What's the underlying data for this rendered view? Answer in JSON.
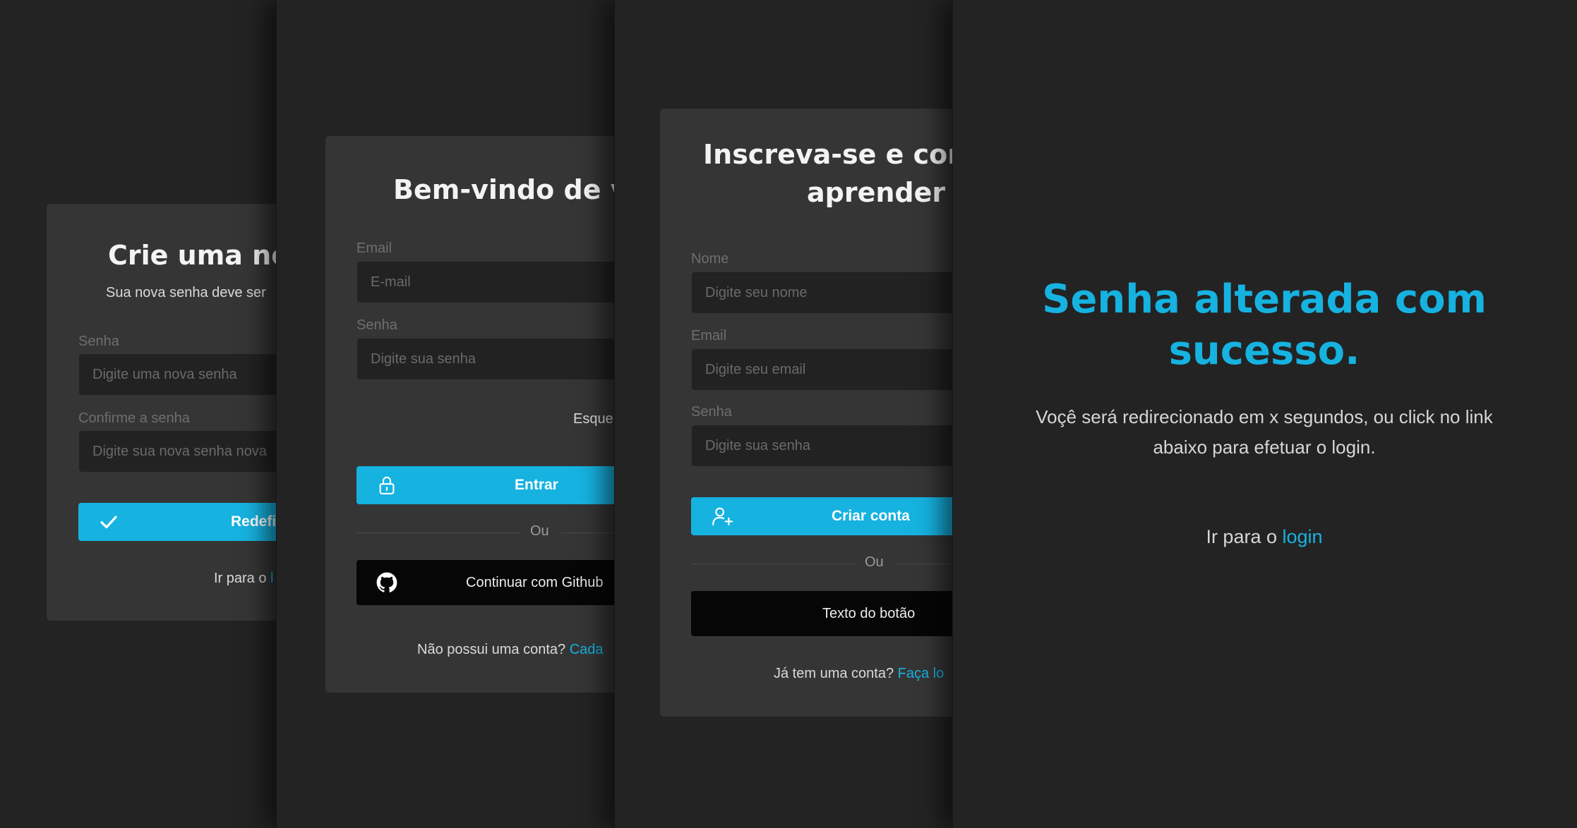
{
  "colors": {
    "accent": "#16b2e0",
    "background": "#232323",
    "card": "#353535",
    "input": "#222222",
    "dark_button": "#060606"
  },
  "reset_password": {
    "title": "Crie uma no",
    "subtitle": "Sua nova senha deve ser",
    "password_label": "Senha",
    "password_placeholder": "Digite uma nova senha",
    "confirm_label": "Confirme a senha",
    "confirm_placeholder": "Digite sua nova senha nova",
    "submit_label": "Redefinir",
    "submit_icon": "check-icon",
    "footer_text": "Ir para o ",
    "footer_link": "l"
  },
  "login": {
    "title": "Bem-vindo de v",
    "email_label": "Email",
    "email_placeholder": "E-mail",
    "password_label": "Senha",
    "password_placeholder": "Digite sua senha",
    "forgot_link": "Esque",
    "submit_label": "Entrar",
    "submit_icon": "lock-icon",
    "divider_text": "Ou",
    "github_label": "Continuar com Github",
    "github_icon": "github-icon",
    "footer_text": "Não possui uma conta? ",
    "footer_link": "Cada"
  },
  "signup": {
    "title_line1": "Inscreva-se e cor",
    "title_line2": "aprender",
    "name_label": "Nome",
    "name_placeholder": "Digite seu nome",
    "email_label": "Email",
    "email_placeholder": "Digite seu email",
    "password_label": "Senha",
    "password_placeholder": "Digite sua senha",
    "submit_label": "Criar conta",
    "submit_icon": "user-plus-icon",
    "divider_text": "Ou",
    "secondary_label": "Texto do botão",
    "footer_text": "Já tem uma conta? ",
    "footer_link": "Faça lo"
  },
  "success": {
    "title": "Senha alterada com sucesso.",
    "message": "Voçê será redirecionado em x segundos, ou click no link abaixo para efetuar o login.",
    "footer_text": "Ir para o ",
    "footer_link": "login"
  }
}
